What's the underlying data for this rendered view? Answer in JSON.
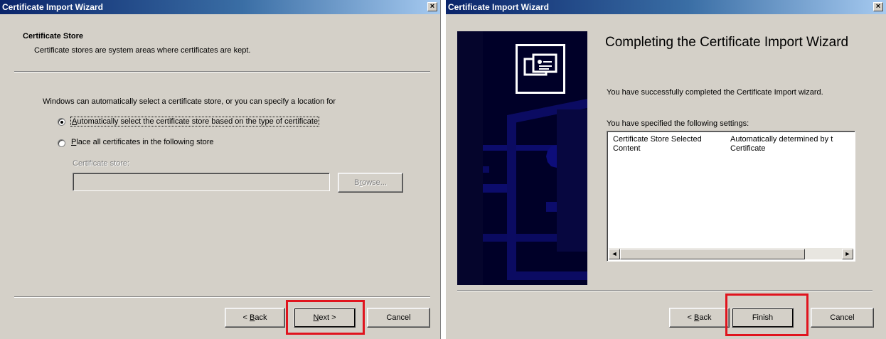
{
  "left_window": {
    "title": "Certificate Import Wizard",
    "close_glyph": "×",
    "header_title": "Certificate Store",
    "header_subtitle": "Certificate stores are system areas where certificates are kept.",
    "intro": "Windows can automatically select a certificate store, or you can specify a location for",
    "radio_auto": {
      "accel": "A",
      "rest": "utomatically select the certificate store based on the type of certificate",
      "selected": true
    },
    "radio_place": {
      "accel": "P",
      "rest": "lace all certificates in the following store",
      "selected": false
    },
    "store_label": "Certificate store:",
    "store_value": "",
    "browse": {
      "accel": "r",
      "pre": "B",
      "post": "owse..."
    },
    "back": {
      "pre": "< ",
      "accel": "B",
      "post": "ack"
    },
    "next": {
      "accel": "N",
      "post": "ext >"
    },
    "cancel": "Cancel",
    "highlight_color": "#e0141e"
  },
  "right_window": {
    "title": "Certificate Import Wizard",
    "close_glyph": "×",
    "heading": "Completing the Certificate Import Wizard",
    "success_text": "You have successfully completed the Certificate Import wizard.",
    "settings_label": "You have specified the following settings:",
    "settings": [
      {
        "key": "Certificate Store Selected",
        "value": "Automatically determined by t"
      },
      {
        "key": "Content",
        "value": "Certificate"
      }
    ],
    "scroll_left": "◄",
    "scroll_right": "►",
    "back": {
      "pre": "< ",
      "accel": "B",
      "post": "ack"
    },
    "finish": "Finish",
    "cancel": "Cancel",
    "panel_color": "#000028",
    "icon": "certificate-icon"
  }
}
